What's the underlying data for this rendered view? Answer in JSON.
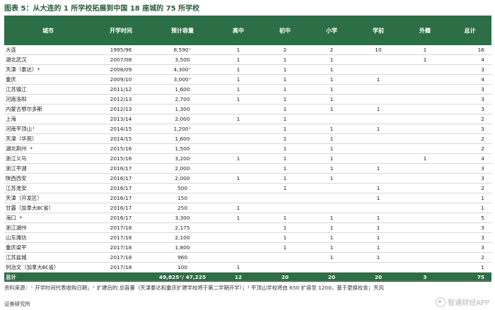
{
  "title": "图表 5：从大连的 1 所学校拓展到中国 18 座城的 75 所学校",
  "headers": [
    "城市",
    "开学时间",
    "预计容量",
    "高中",
    "初中",
    "小学",
    "学前",
    "外籍",
    "总计"
  ],
  "rows": [
    [
      "大连",
      "1995/96",
      "8,590⁺",
      "1",
      "2",
      "2",
      "10",
      "1",
      "16"
    ],
    [
      "湖北武汉",
      "2007/08",
      "3,500",
      "1",
      "1",
      "1",
      "",
      "1",
      "4"
    ],
    [
      "天津（泰达）*",
      "2008/09",
      "4,300⁺",
      "1",
      "1",
      "1",
      "",
      "",
      "3"
    ],
    [
      "重庆",
      "2009/10",
      "3,000⁺",
      "1",
      "1",
      "1",
      "1",
      "",
      "4"
    ],
    [
      "江苏镇江",
      "2011/12",
      "1,600",
      "1",
      "1",
      "1",
      "",
      "",
      "3"
    ],
    [
      "河南洛阳",
      "2012/13",
      "2,700",
      "1",
      "1",
      "1",
      "",
      "",
      "3"
    ],
    [
      "内蒙古鄂尔多斯",
      "2012/13",
      "1,300",
      "",
      "1",
      "1",
      "1",
      "",
      "3"
    ],
    [
      "上海",
      "2013/14",
      "2,000",
      "1",
      "1",
      "",
      "",
      "",
      "2"
    ],
    [
      "河南平顶山¹",
      "2014/15",
      "1,200⁺",
      "",
      "1",
      "1",
      "1",
      "",
      "3"
    ],
    [
      "天津（华苑）",
      "2014/15",
      "1,600",
      "",
      "1",
      "1",
      "",
      "",
      "2"
    ],
    [
      "湖北荆州 *",
      "2015/16",
      "1,500",
      "",
      "1",
      "1",
      "",
      "",
      "2"
    ],
    [
      "浙江义乌",
      "2015/16",
      "3,200",
      "1",
      "1",
      "1",
      "",
      "1",
      "4"
    ],
    [
      "浙江平湖",
      "2016/17",
      "2,000",
      "",
      "1",
      "1",
      "1",
      "",
      "3"
    ],
    [
      "陕西西安",
      "2016/17",
      "2,000",
      "1",
      "1",
      "1",
      "",
      "",
      "3"
    ],
    [
      "江苏淮安",
      "2016/17",
      "500",
      "",
      "1",
      "",
      "1",
      "",
      "2"
    ],
    [
      "天津（开发区）",
      "2016/17",
      "150",
      "",
      "",
      "",
      "1",
      "",
      "1"
    ],
    [
      "甘露（加拿大BC省）",
      "2016/17",
      "250",
      "1",
      "",
      "",
      "",
      "",
      "1"
    ],
    [
      "海口 *",
      "2016/17",
      "3,300",
      "1",
      "1",
      "1",
      "1",
      "",
      "5"
    ],
    [
      "浙江湖州",
      "2017/18",
      "2,175",
      "",
      "1",
      "1",
      "1",
      "",
      "3"
    ],
    [
      "山东潍坊",
      "2017/18",
      "2,100",
      "",
      "1",
      "1",
      "1",
      "",
      "3"
    ],
    [
      "重庆梁平",
      "2017/18",
      "1,800",
      "",
      "1",
      "1",
      "1",
      "",
      "3"
    ],
    [
      "江苏盐城",
      "2017/18",
      "960",
      "",
      "",
      "1",
      "1",
      "",
      "2"
    ],
    [
      "列治文（加拿大BC省）",
      "2017/18",
      "100",
      "1",
      "",
      "",
      "",
      "",
      "1"
    ]
  ],
  "total": [
    "总计",
    "",
    "49,825⁺/ 47,225",
    "12",
    "20",
    "20",
    "20",
    "3",
    "75"
  ],
  "footnote": "资料来源：⁺ 开学时间代表收购日期；⁺ 扩建后的  总容量（天津泰达和重庆扩建学校将于第二学期开学）；¹ 平顶山学校将由 650 扩容至 1200，基于更换校舍；天风",
  "source_line2": "证券研究所",
  "watermark": "智通财经APP",
  "colors": {
    "header_bg": "#2c6e45",
    "title": "#2a5d3e"
  }
}
